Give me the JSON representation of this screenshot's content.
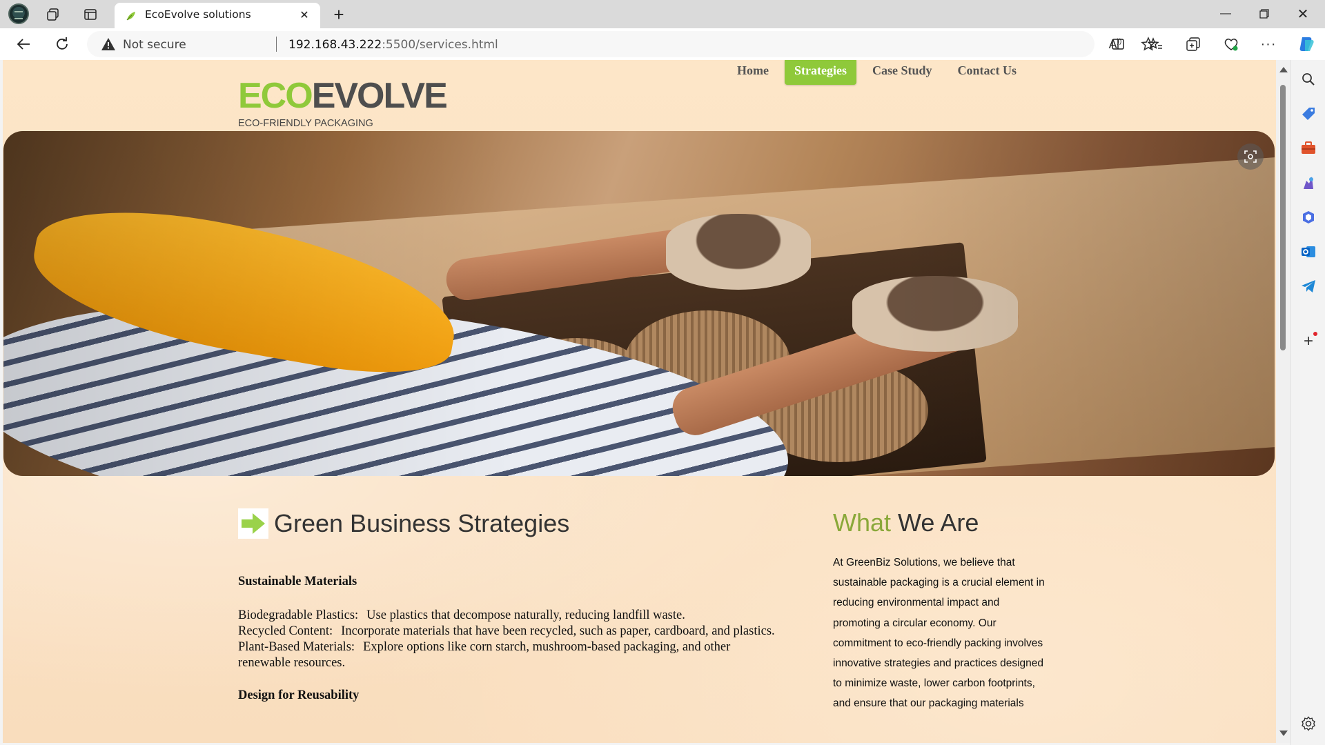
{
  "browser": {
    "tab_title": "EcoEvolve solutions",
    "security_label": "Not secure",
    "url_host": "192.168.43.222",
    "url_rest": ":5500/services.html"
  },
  "site": {
    "logo_eco": "ECO",
    "logo_evolve": "EVOLVE",
    "tagline": "ECO-FRIENDLY PACKAGING",
    "nav": [
      {
        "label": "Home",
        "active": false
      },
      {
        "label": "Strategies",
        "active": true
      },
      {
        "label": "Case Study",
        "active": false
      },
      {
        "label": "Contact Us",
        "active": false
      }
    ]
  },
  "main": {
    "title": "Green Business Strategies",
    "section1_heading": "Sustainable Materials",
    "items": [
      {
        "label": "Biodegradable Plastics:",
        "text": "Use plastics that decompose naturally, reducing landfill waste."
      },
      {
        "label": "Recycled Content:",
        "text": "Incorporate materials that have been recycled, such as paper, cardboard, and plastics."
      },
      {
        "label": "Plant-Based Materials:",
        "text": "Explore options like corn starch, mushroom-based packaging, and other renewable resources."
      }
    ],
    "section2_heading": "Design for Reusability"
  },
  "aside": {
    "title_highlight": "What",
    "title_rest": " We Are",
    "text": "At GreenBiz Solutions, we believe that sustainable packaging is a crucial element in reducing environmental impact and promoting a circular economy. Our commitment to eco-friendly packing involves innovative strategies and practices designed to minimize waste, lower carbon footprints, and ensure that our packaging materials"
  },
  "colors": {
    "accent_green": "#8fc93a",
    "page_bg": "#fbe2c4"
  }
}
